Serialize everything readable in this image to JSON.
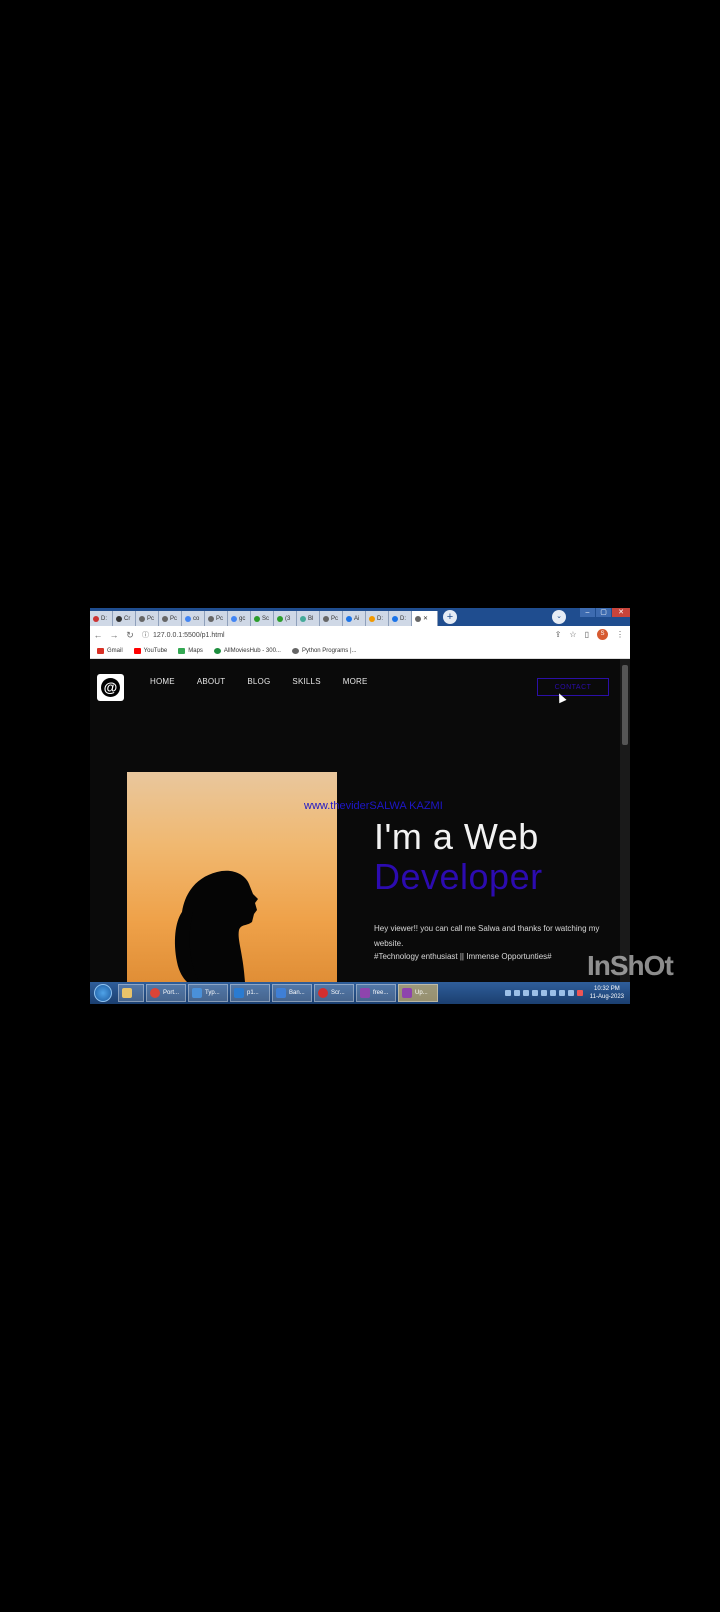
{
  "browser": {
    "tabs": [
      "D:",
      "Cr",
      "Pc",
      "Pc",
      "co",
      "Pc",
      "gc",
      "Sc",
      "(3",
      "Bl",
      "Pc",
      "Ai",
      "D:",
      "D:",
      ""
    ],
    "url": "127.0.0.1:5500/p1.html",
    "bookmarks": [
      "Gmail",
      "YouTube",
      "Maps",
      "AllMoviesHub - 300...",
      "Python Programs |..."
    ]
  },
  "site": {
    "nav": [
      "HOME",
      "ABOUT",
      "BLOG",
      "SKILLS",
      "MORE"
    ],
    "contact_label": "CONTACT",
    "watermark": "www.theviderSALWA KAZMI",
    "headline_line1": "I'm a Web",
    "headline_line2": "Developer",
    "intro": "Hey viewer!! you can call me Salwa and thanks for watching my website.",
    "tags": "#Technology enthusiast || Immense Opportunties#"
  },
  "taskbar": {
    "items": [
      "Port...",
      "Typ...",
      "p1...",
      "Ban...",
      "Scr...",
      "free...",
      "Up..."
    ],
    "time": "10:32 PM",
    "date": "11-Aug-2023"
  },
  "overlay": {
    "brand": "InShOt"
  },
  "colors": {
    "accent": "#2c0bb0",
    "background": "#0a0a0a"
  }
}
